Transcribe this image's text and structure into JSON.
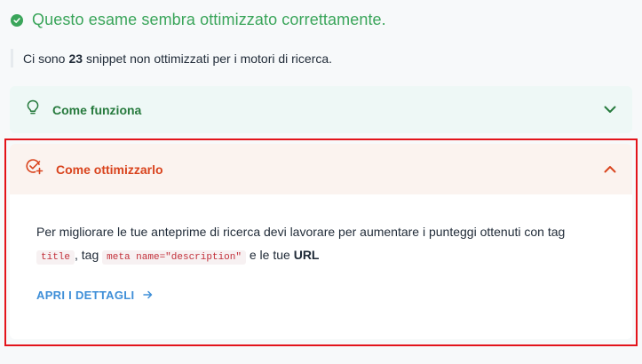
{
  "status": {
    "icon": "check-circle-icon",
    "text": "Questo esame sembra ottimizzato correttamente.",
    "color": "#3aa55a"
  },
  "info": {
    "prefix": "Ci sono",
    "count": "23",
    "suffix": "snippet non ottimizzati per i motori di ricerca."
  },
  "how_it_works": {
    "icon": "lightbulb-icon",
    "label": "Come funziona",
    "expanded": false,
    "color": "#267a3d"
  },
  "how_to_optimize": {
    "icon": "check-plus-icon",
    "label": "Come ottimizzarlo",
    "expanded": true,
    "color": "#d9441e",
    "body": {
      "text_1": "Per migliorare le tue anteprime di ricerca devi lavorare per aumentare i punteggi ottenuti con tag",
      "code_1": "title",
      "text_2": ", tag",
      "code_2": "meta name=\"description\"",
      "text_3": "e le tue",
      "url_label": "URL"
    },
    "details_link": "APRI I DETTAGLI",
    "details_color": "#3f8fd8"
  },
  "highlight_color": "#e3141b"
}
